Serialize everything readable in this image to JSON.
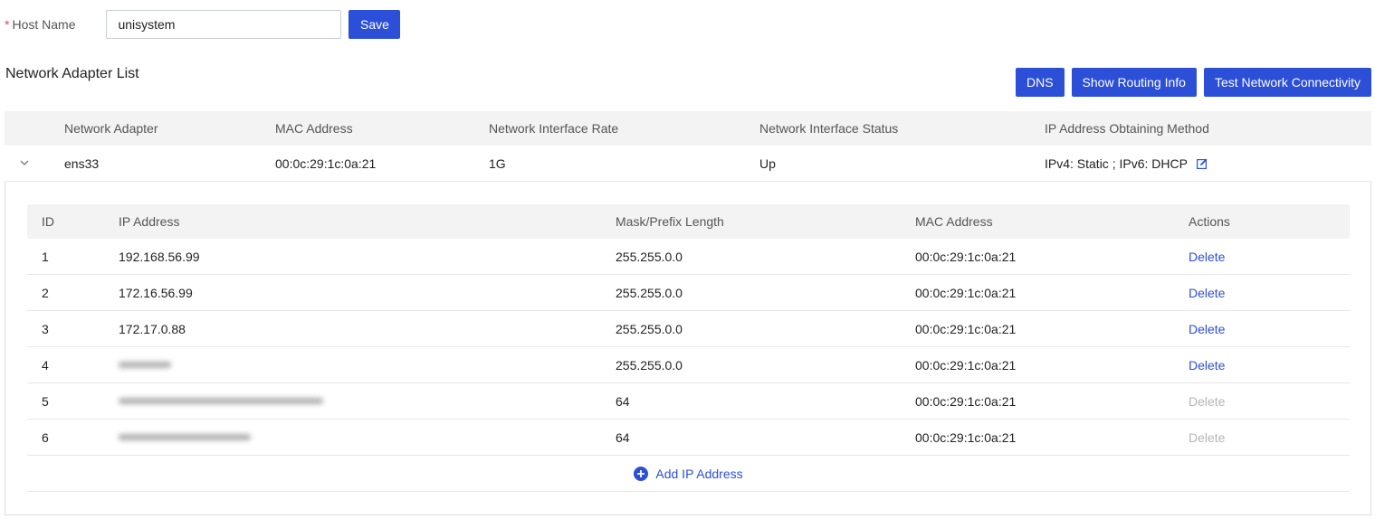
{
  "host": {
    "required_mark": "*",
    "label": "Host Name",
    "value": "unisystem",
    "save_label": "Save"
  },
  "section": {
    "title": "Network Adapter List"
  },
  "actions": {
    "dns": "DNS",
    "routing": "Show Routing Info",
    "connectivity": "Test Network Connectivity"
  },
  "adapter_table": {
    "headers": [
      "Network Adapter",
      "MAC Address",
      "Network Interface Rate",
      "Network Interface Status",
      "IP Address Obtaining Method"
    ],
    "row": {
      "adapter": "ens33",
      "mac": "00:0c:29:1c:0a:21",
      "rate": "1G",
      "status": "Up",
      "method": "IPv4: Static ; IPv6: DHCP"
    }
  },
  "ip_table": {
    "headers": [
      "ID",
      "IP Address",
      "Mask/Prefix Length",
      "MAC Address",
      "Actions"
    ],
    "rows": [
      {
        "id": "1",
        "ip": "192.168.56.99",
        "mask": "255.255.0.0",
        "mac": "00:0c:29:1c:0a:21",
        "action": "Delete"
      },
      {
        "id": "2",
        "ip": "172.16.56.99",
        "mask": "255.255.0.0",
        "mac": "00:0c:29:1c:0a:21",
        "action": "Delete"
      },
      {
        "id": "3",
        "ip": "172.17.0.88",
        "mask": "255.255.0.0",
        "mac": "00:0c:29:1c:0a:21",
        "action": "Delete"
      },
      {
        "id": "4",
        "ip": "",
        "mask": "255.255.0.0",
        "mac": "00:0c:29:1c:0a:21",
        "action": "Delete"
      },
      {
        "id": "5",
        "ip": "",
        "mask": "64",
        "mac": "00:0c:29:1c:0a:21",
        "action": "Delete"
      },
      {
        "id": "6",
        "ip": "",
        "mask": "64",
        "mac": "00:0c:29:1c:0a:21",
        "action": "Delete"
      }
    ],
    "add_label": "Add IP Address"
  },
  "colors": {
    "primary": "#2c4fd7",
    "required": "#e34d59",
    "disabled": "#b5b5b5",
    "header_bg": "#f3f3f3"
  },
  "icons": {
    "expand": "chevron-down-icon",
    "edit": "edit-icon",
    "add": "plus-circle-icon"
  }
}
